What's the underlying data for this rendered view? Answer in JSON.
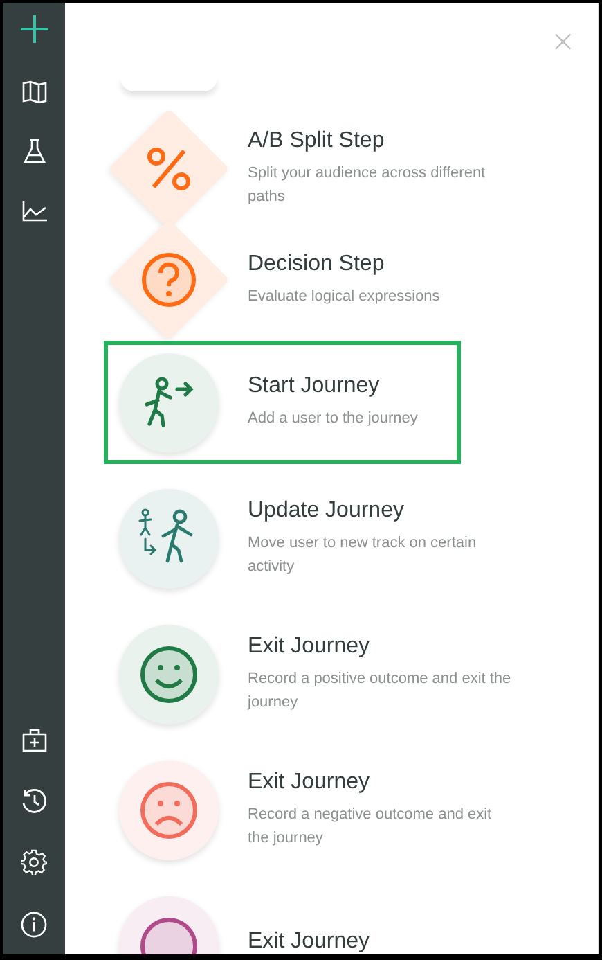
{
  "close_button": {
    "label": "×"
  },
  "steps": [
    {
      "kind": "diamond",
      "title": "A/B Split Step",
      "description": "Split your audience across different paths",
      "color": "#ff6a13",
      "selected": false
    },
    {
      "kind": "diamond",
      "title": "Decision Step",
      "description": "Evaluate logical expressions",
      "color": "#ff6a13",
      "selected": false
    },
    {
      "kind": "circle",
      "title": "Start Journey",
      "description": "Add a user to the journey",
      "color": "#1f7a45",
      "selected": true
    },
    {
      "kind": "circle",
      "title": "Update Journey",
      "description": "Move user to new track on certain activity",
      "color": "#2a7a70",
      "selected": false
    },
    {
      "kind": "circle",
      "title": "Exit Journey",
      "description": "Record a positive outcome and exit the journey",
      "color": "#1f7a45",
      "selected": false
    },
    {
      "kind": "circle",
      "title": "Exit Journey",
      "description": "Record a negative outcome and exit the journey",
      "color": "#f26b5b",
      "selected": false
    },
    {
      "kind": "circle",
      "title": "Exit Journey",
      "color": "#b04a8a",
      "selected": false
    }
  ]
}
